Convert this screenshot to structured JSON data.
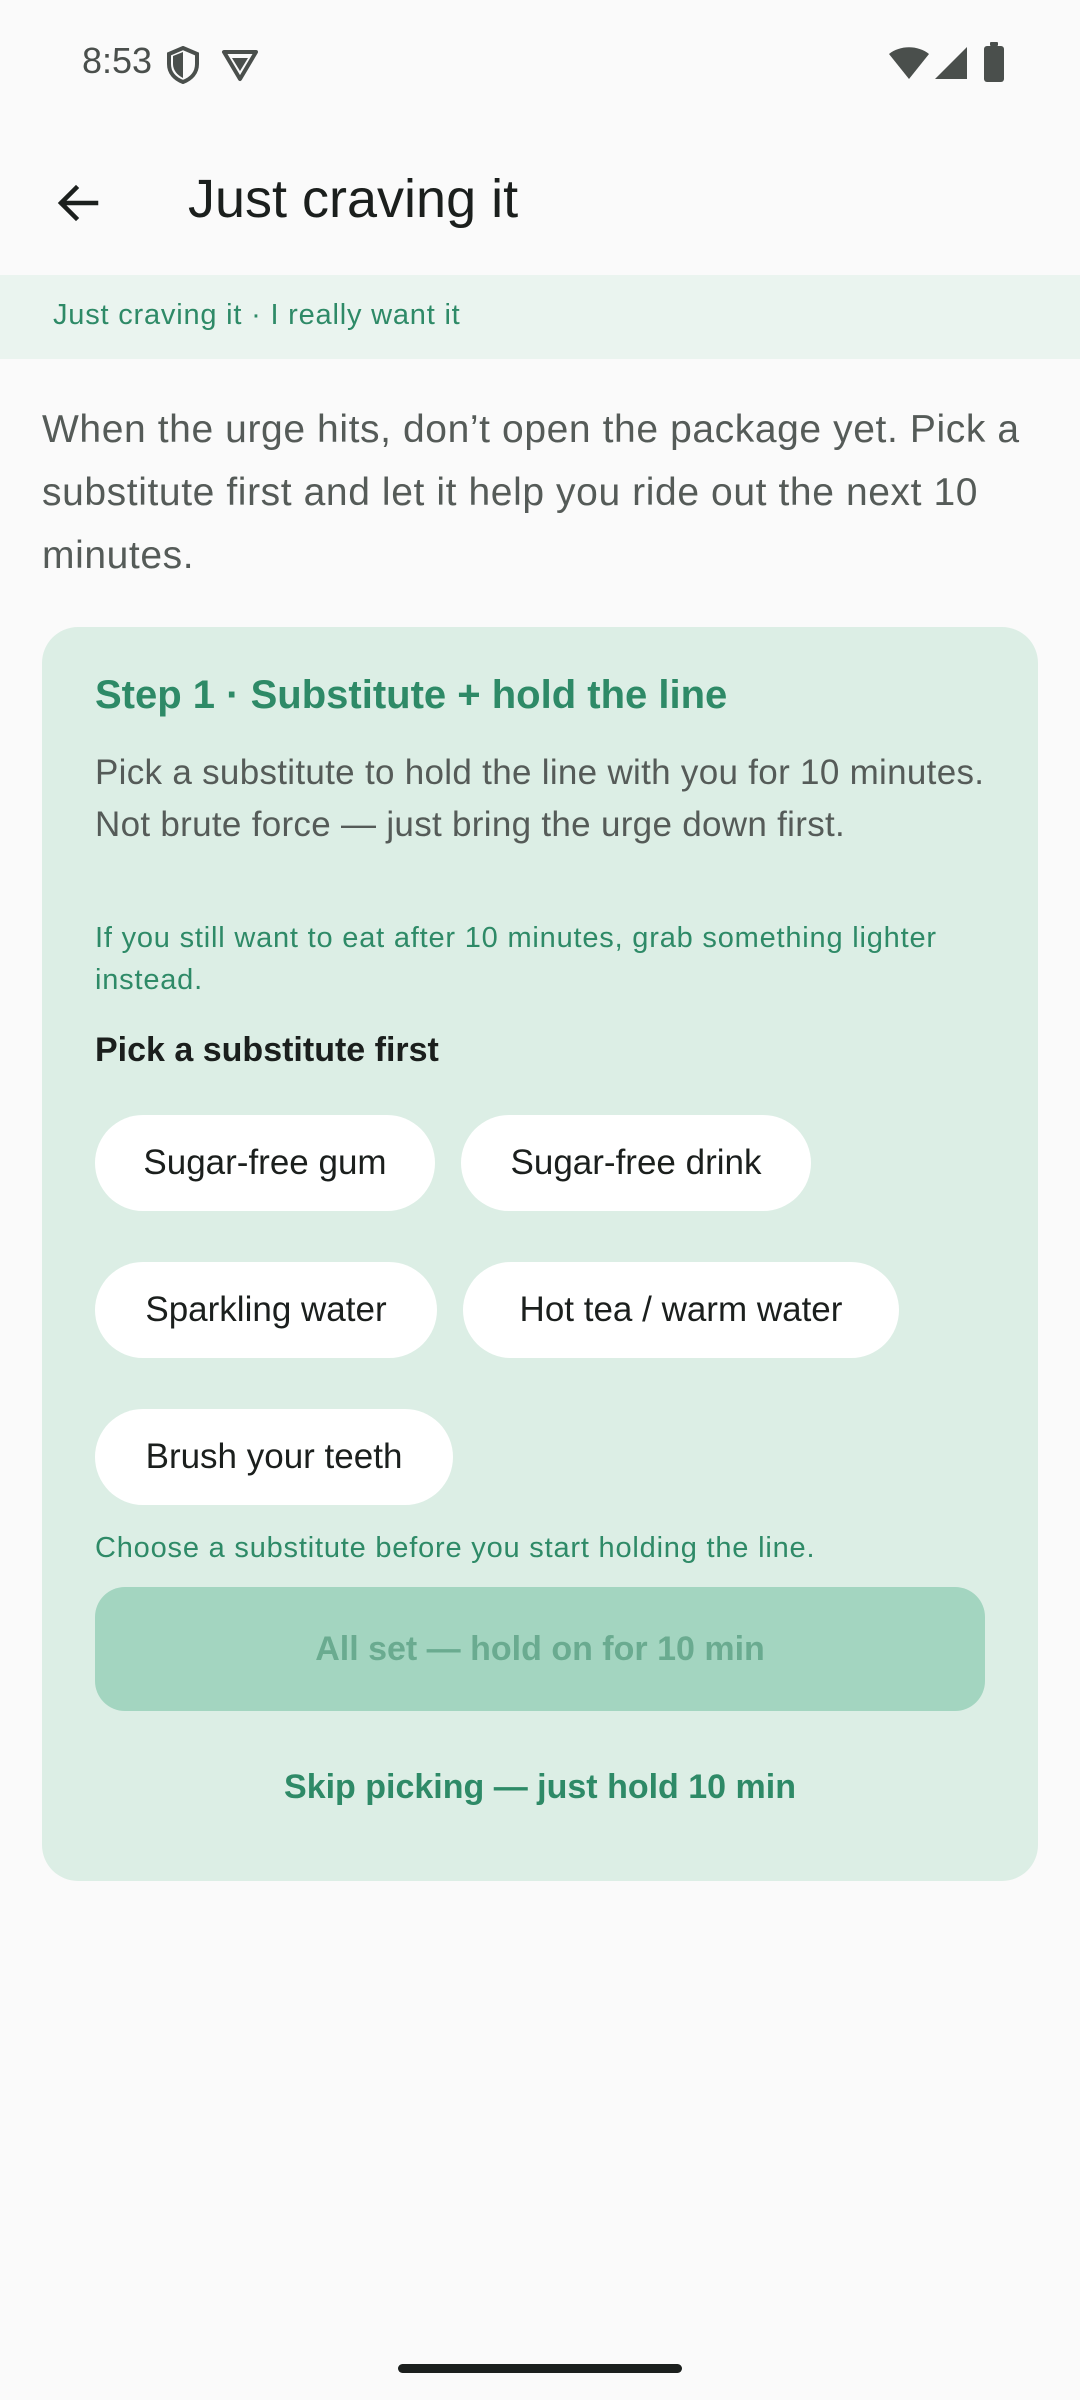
{
  "status_bar": {
    "time": "8:53",
    "left_icons": [
      "shield-icon",
      "vpn-icon"
    ],
    "right_icons": [
      "wifi-icon",
      "signal-icon",
      "battery-icon"
    ]
  },
  "app_bar": {
    "title": "Just craving it",
    "back_icon": "arrow-left-icon"
  },
  "banner": {
    "text": "Just craving it · I really want it"
  },
  "intro": {
    "text": "When the urge hits, don’t open the package yet. Pick a substitute first and let it help you ride out the next 10 minutes."
  },
  "card": {
    "title": "Step 1 · Substitute + hold the line",
    "description": "Pick a substitute to hold the line with you for 10 minutes. Not brute force — just bring the urge down first.",
    "note": "If you still want to eat after 10 minutes, grab something lighter instead.",
    "section_label": "Pick a substitute first",
    "chips": [
      {
        "label": "Sugar-free gum"
      },
      {
        "label": "Sugar-free drink"
      },
      {
        "label": "Sparkling water"
      },
      {
        "label": "Hot tea / warm water"
      },
      {
        "label": "Brush your teeth"
      }
    ],
    "hint": "Choose a substitute before you start holding the line.",
    "primary_button": "All set — hold on for 10 min",
    "skip_button": "Skip picking — just hold 10 min"
  },
  "colors": {
    "accent": "#2e8a67",
    "card_bg": "#dceee5",
    "banner_bg": "#eaf4ef",
    "disabled_button_bg": "#a3d5c0"
  }
}
